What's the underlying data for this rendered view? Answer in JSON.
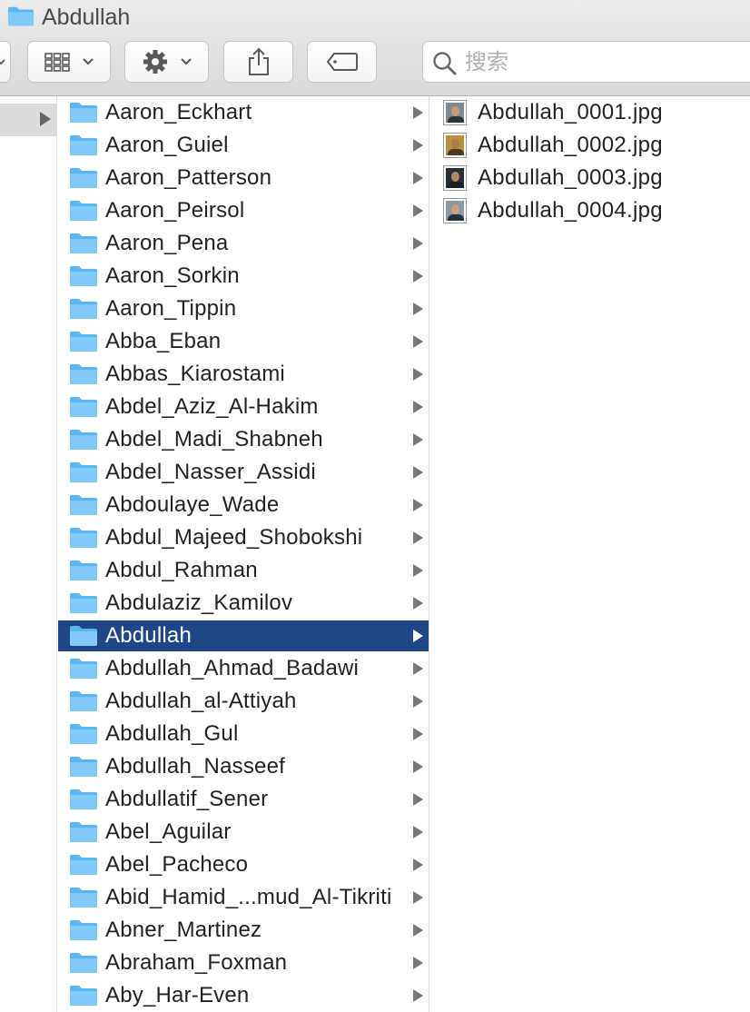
{
  "window": {
    "title": "Abdullah"
  },
  "search": {
    "placeholder": "搜索",
    "value": ""
  },
  "colors": {
    "selection": "#1f4686",
    "folder": "#5ab6f2"
  },
  "folders": [
    "Aaron_Eckhart",
    "Aaron_Guiel",
    "Aaron_Patterson",
    "Aaron_Peirsol",
    "Aaron_Pena",
    "Aaron_Sorkin",
    "Aaron_Tippin",
    "Abba_Eban",
    "Abbas_Kiarostami",
    "Abdel_Aziz_Al-Hakim",
    "Abdel_Madi_Shabneh",
    "Abdel_Nasser_Assidi",
    "Abdoulaye_Wade",
    "Abdul_Majeed_Shobokshi",
    "Abdul_Rahman",
    "Abdulaziz_Kamilov",
    "Abdullah",
    "Abdullah_Ahmad_Badawi",
    "Abdullah_al-Attiyah",
    "Abdullah_Gul",
    "Abdullah_Nasseef",
    "Abdullatif_Sener",
    "Abel_Aguilar",
    "Abel_Pacheco",
    "Abid_Hamid_...mud_Al-Tikriti",
    "Abner_Martinez",
    "Abraham_Foxman",
    "Aby_Har-Even"
  ],
  "selected_folder": "Abdullah",
  "files": [
    {
      "name": "Abdullah_0001.jpg",
      "icon": "photo-thumbnail-icon",
      "bg": "#7e8a90",
      "skin": "#c49a7a",
      "cloth": "#2c3440"
    },
    {
      "name": "Abdullah_0002.jpg",
      "icon": "photo-thumbnail-icon",
      "bg": "#b8913c",
      "skin": "#b07850",
      "cloth": "#4a3a22"
    },
    {
      "name": "Abdullah_0003.jpg",
      "icon": "photo-thumbnail-icon",
      "bg": "#2a2e36",
      "skin": "#b88864",
      "cloth": "#1a1e26"
    },
    {
      "name": "Abdullah_0004.jpg",
      "icon": "photo-thumbnail-icon",
      "bg": "#8e9a9e",
      "skin": "#c9a080",
      "cloth": "#26303c"
    }
  ]
}
